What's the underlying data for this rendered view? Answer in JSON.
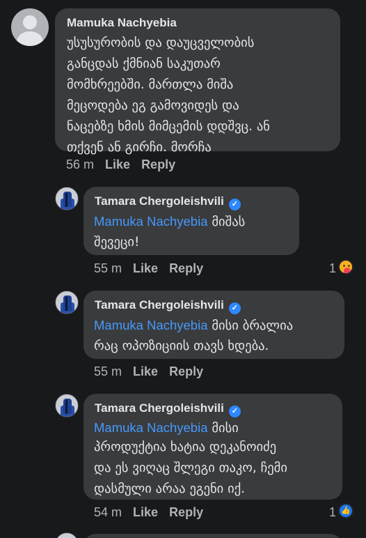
{
  "comments": [
    {
      "author": "Mamuka Nachyebia",
      "verified": false,
      "mention": "",
      "text": "უსუსურობის და დაუცველობის\nგანცდას ქმნიან საკუთარ\nმომხრეებში. მართლა მიშა\nმეცოდება ეგ გამოვიდეს და\nნაცებზე ხმის მიმცემის დდშვც. ან\nთქვენ ან გირჩი. მორჩა",
      "time": "56 m",
      "like_label": "Like",
      "reply_label": "Reply",
      "reaction_count": "",
      "reaction_icon": ""
    },
    {
      "author": "Tamara Chergoleishvili",
      "verified": true,
      "mention": "Mamuka Nachyebia",
      "text_first": " მიშას",
      "text": "შევეცი!",
      "time": "55 m",
      "like_label": "Like",
      "reply_label": "Reply",
      "reaction_count": "1",
      "reaction_icon": "care-reaction-icon"
    },
    {
      "author": "Tamara Chergoleishvili",
      "verified": true,
      "mention": "Mamuka Nachyebia",
      "text_first": " მისი ბრალია",
      "text": "რაც ოპოზიციის თავს ხდება.",
      "time": "55 m",
      "like_label": "Like",
      "reply_label": "Reply",
      "reaction_count": "",
      "reaction_icon": ""
    },
    {
      "author": "Tamara Chergoleishvili",
      "verified": true,
      "mention": "Mamuka Nachyebia",
      "text_first": " მისი",
      "text": "პროდუქტია ხატია დეკანოიძე\nდა ეს ვიღაც შლეგი თაკო, ჩემი\nდასმული არაა ეგენი იქ.",
      "time": "54 m",
      "like_label": "Like",
      "reply_label": "Reply",
      "reaction_count": "1",
      "reaction_icon": "like-reaction-icon"
    }
  ],
  "colors": {
    "background": "#18191a",
    "bubble": "#3a3b3c",
    "text": "#e4e6eb",
    "muted": "#b0b3b8",
    "mention": "#4599ff",
    "verified": "#2d88ff"
  }
}
